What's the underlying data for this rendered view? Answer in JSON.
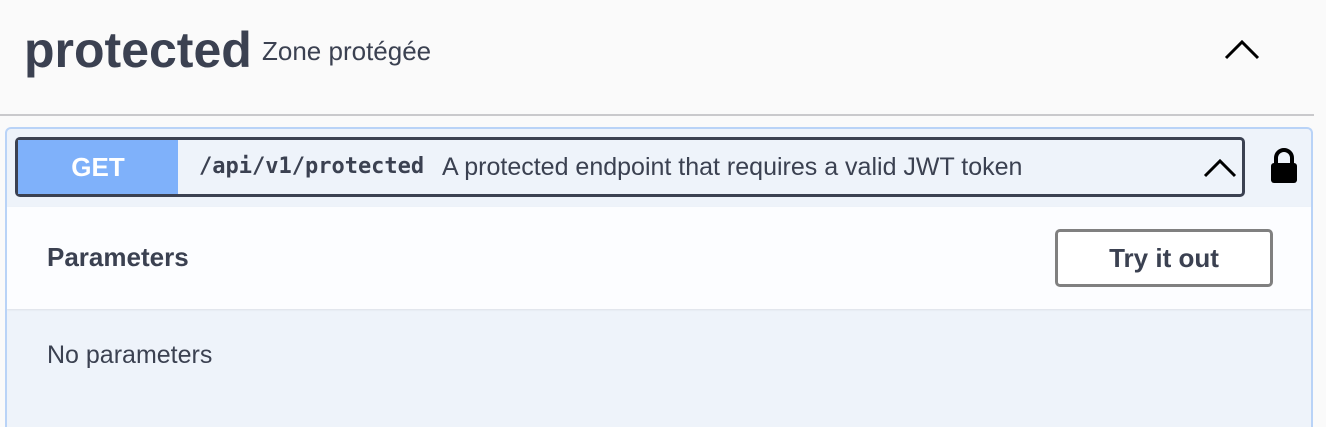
{
  "tag": {
    "name": "protected",
    "description": "Zone protégée"
  },
  "operation": {
    "method": "GET",
    "path": "/api/v1/protected",
    "summary": "A protected endpoint that requires a valid JWT token",
    "method_color": "#7fb1fa",
    "border_color": "#b9d3f7",
    "background_color": "#eef3fa"
  },
  "parameters": {
    "title": "Parameters",
    "try_button_label": "Try it out",
    "empty_text": "No parameters"
  },
  "icons": {
    "tag_toggle": "chevron-up-icon",
    "summary_toggle": "chevron-up-icon",
    "auth": "lock-icon"
  }
}
